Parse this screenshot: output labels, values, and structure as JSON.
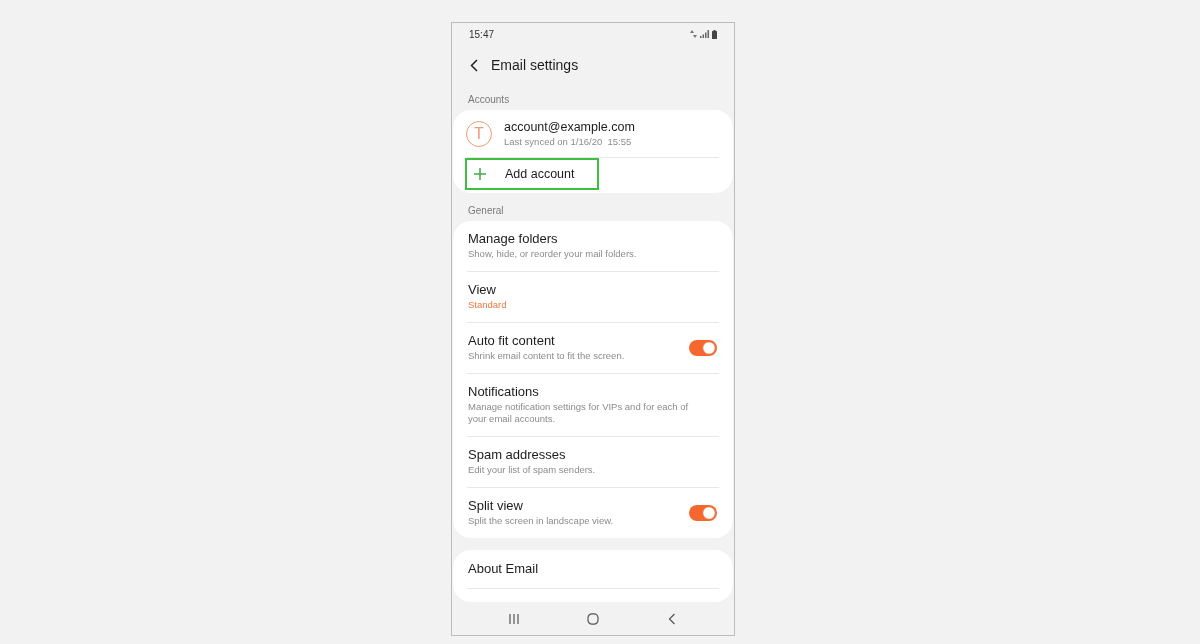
{
  "status_bar": {
    "time": "15:47"
  },
  "header": {
    "title": "Email settings"
  },
  "sections": [
    {
      "label": "Accounts",
      "items": [
        {
          "kind": "account",
          "avatar": "T",
          "title": "account@example.com",
          "subtitle": "Last synced on 1/16/20  15:55",
          "highlighted": false
        },
        {
          "kind": "add",
          "title": "Add account",
          "highlighted": true
        }
      ]
    },
    {
      "label": "General",
      "items": [
        {
          "kind": "setting",
          "title": "Manage folders",
          "subtitle": "Show, hide, or reorder your mail folders."
        },
        {
          "kind": "value",
          "title": "View",
          "subtitle": "Standard"
        },
        {
          "kind": "toggle",
          "title": "Auto fit content",
          "subtitle": "Shrink email content to fit the screen.",
          "on": true
        },
        {
          "kind": "setting",
          "title": "Notifications",
          "subtitle": "Manage notification settings for VIPs and for each of your email accounts."
        },
        {
          "kind": "setting",
          "title": "Spam addresses",
          "subtitle": "Edit your list of spam senders."
        },
        {
          "kind": "toggle",
          "title": "Split view",
          "subtitle": "Split the screen in landscape view.",
          "on": true
        }
      ]
    },
    {
      "items": [
        {
          "kind": "setting",
          "title": "About Email"
        }
      ]
    }
  ]
}
